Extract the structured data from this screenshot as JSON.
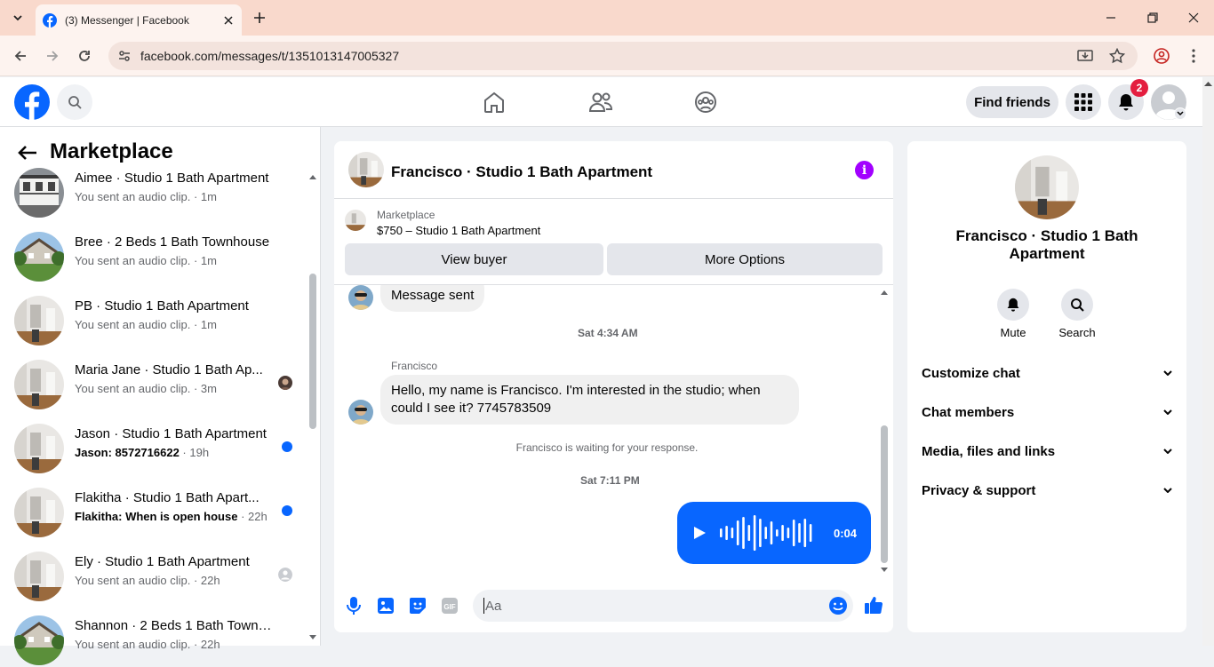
{
  "browser": {
    "tab_title": "(3) Messenger | Facebook",
    "url": "facebook.com/messages/t/1351013147005327"
  },
  "header": {
    "find_friends": "Find friends",
    "notifications_count": "2"
  },
  "left": {
    "title": "Marketplace",
    "conversations": [
      {
        "name": "Aimee · Studio 1 Bath Apartment",
        "preview": "You sent an audio clip.",
        "time": "1m",
        "unread": false
      },
      {
        "name": "Bree · 2 Beds 1 Bath Townhouse",
        "preview": "You sent an audio clip.",
        "time": "1m",
        "unread": false
      },
      {
        "name": "PB · Studio 1 Bath Apartment",
        "preview": "You sent an audio clip.",
        "time": "1m",
        "unread": false
      },
      {
        "name": "Maria Jane · Studio 1 Bath Ap...",
        "preview": "You sent an audio clip.",
        "time": "3m",
        "unread": false
      },
      {
        "name": "Jason · Studio 1 Bath Apartment",
        "preview": "Jason: 8572716622",
        "time": "19h",
        "unread": true
      },
      {
        "name": "Flakitha · Studio 1 Bath Apart...",
        "preview": "Flakitha: When is open house",
        "time": "22h",
        "unread": true
      },
      {
        "name": "Ely · Studio 1 Bath Apartment",
        "preview": "You sent an audio clip.",
        "time": "22h",
        "unread": false
      },
      {
        "name": "Shannon · 2 Beds 1 Bath Townho...",
        "preview": "You sent an audio clip.",
        "time": "22h",
        "unread": false
      }
    ],
    "separator": " · "
  },
  "chat": {
    "title": "Francisco · Studio 1 Bath Apartment",
    "marketplace_label": "Marketplace",
    "listing": "$750 – Studio 1 Bath Apartment",
    "view_buyer": "View buyer",
    "more_options": "More Options",
    "prev_message": "Message sent",
    "time1": "Sat 4:34 AM",
    "sender": "Francisco",
    "message_line1": "Hello, my name is Francisco. I'm interested in the studio; when",
    "message_line2": "could I see it? 7745783509",
    "waiting": "Francisco is waiting for your response.",
    "time2": "Sat 7:11 PM",
    "audio_duration": "0:04",
    "composer_placeholder": "Aa"
  },
  "right": {
    "name": "Francisco · Studio 1 Bath Apartment",
    "mute": "Mute",
    "search": "Search",
    "sections": [
      "Customize chat",
      "Chat members",
      "Media, files and links",
      "Privacy & support"
    ]
  },
  "colors": {
    "accent": "#0866ff",
    "info": "#a200ff",
    "badge": "#e41e3f",
    "tabbar": "#f9d9cc"
  }
}
